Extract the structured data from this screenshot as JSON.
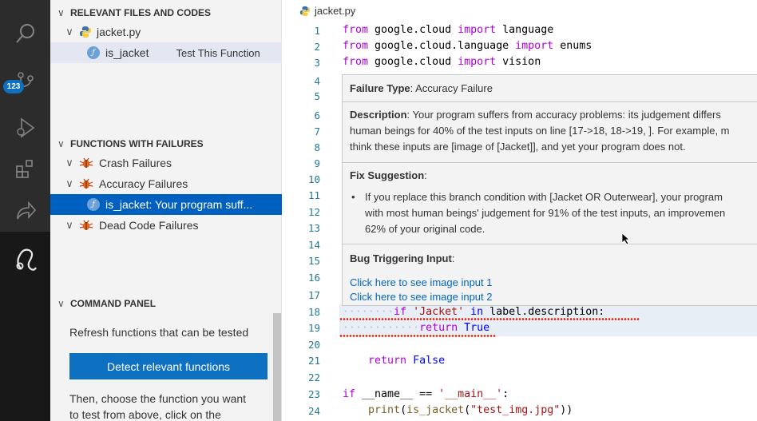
{
  "activity_bar": {
    "source_control_badge": "123"
  },
  "side_panel": {
    "relevant_files": {
      "header": "RELEVANT FILES AND CODES",
      "file_name": "jacket.py",
      "function_name": "is_jacket",
      "test_link": "Test This Function"
    },
    "functions_with_failures": {
      "header": "FUNCTIONS WITH FAILURES",
      "crash": "Crash Failures",
      "accuracy": "Accuracy Failures",
      "selected_item": "is_jacket: Your program suff...",
      "dead_code": "Dead Code Failures"
    },
    "command_panel": {
      "header": "COMMAND PANEL",
      "refresh_text": "Refresh functions that can be tested",
      "detect_button": "Detect relevant functions",
      "then_line1": "Then, choose the function you want",
      "then_line2": "to test from above, click on the"
    }
  },
  "editor": {
    "tab_title": "jacket.py",
    "line_numbers": [
      "1",
      "2",
      "3",
      "4",
      "5",
      "6",
      "7",
      "8",
      "9",
      "10",
      "11",
      "12",
      "13",
      "14",
      "15",
      "16",
      "17",
      "18",
      "19",
      "20",
      "21",
      "22",
      "23",
      "24"
    ],
    "popup": {
      "failure_type_label": "Failure Type",
      "failure_type_value": ": Accuracy Failure",
      "description_label": "Description",
      "description_line1": ": Your program suffers from accuracy problems: its judgement differs",
      "description_line2": "human beings for 40% of the test inputs on line [17->18, 18->19, ]. For example, m",
      "description_line3": "think these inputs are [image of [Jacket]], and yet your program does not.",
      "fix_label": "Fix Suggestion",
      "fix_colon": ":",
      "fix_line1": "If you replace this branch condition with [Jacket OR Outerwear], your program",
      "fix_line2": "with most human beings' judgement for 91% of the test inputs, an improvemen",
      "fix_line3": "62% of your original code.",
      "bug_label": "Bug Triggering Input",
      "bug_colon": ":",
      "link1": "Click here to see image input 1",
      "link2": "Click here to see image input 2"
    }
  }
}
